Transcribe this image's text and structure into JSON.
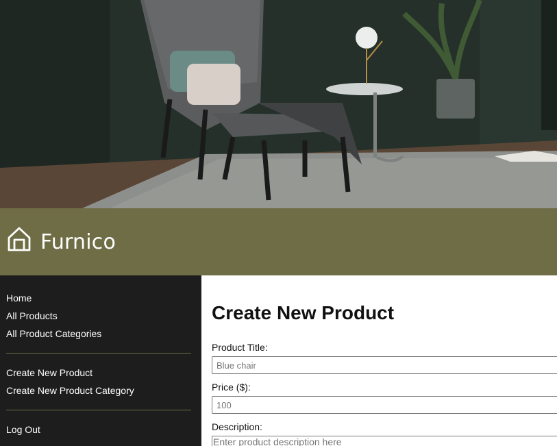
{
  "hero": {
    "image": "living-room-armchair-ottoman-photo"
  },
  "brand": {
    "name": "Furnico",
    "icon": "home-icon",
    "color": "#6f6d45"
  },
  "sidebar": {
    "primary": [
      {
        "label": "Home"
      },
      {
        "label": "All Products"
      },
      {
        "label": "All Product Categories"
      }
    ],
    "admin": [
      {
        "label": "Create New Product"
      },
      {
        "label": "Create New Product Category"
      }
    ],
    "account": [
      {
        "label": "Log Out"
      }
    ]
  },
  "main": {
    "title": "Create New Product",
    "fields": {
      "title": {
        "label": "Product Title:",
        "placeholder": "Blue chair",
        "value": ""
      },
      "price": {
        "label": "Price ($):",
        "placeholder": "100",
        "value": ""
      },
      "description": {
        "label": "Description:",
        "placeholder": "Enter product description here",
        "value": ""
      }
    }
  }
}
